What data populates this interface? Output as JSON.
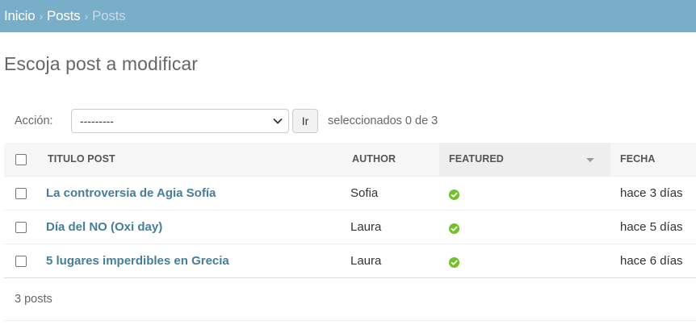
{
  "breadcrumbs": {
    "home": "Inicio",
    "separator": "›",
    "app": "Posts",
    "current": "Posts"
  },
  "page": {
    "title": "Escoja post a modificar"
  },
  "actions": {
    "label": "Acción:",
    "selected_option": "---------",
    "go_label": "Ir",
    "counter": "seleccionados 0 de 3"
  },
  "table": {
    "headers": {
      "title": "Titulo post",
      "author": "Author",
      "featured": "Featured",
      "date": "Fecha"
    },
    "rows": [
      {
        "title": "La controversia de Agia Sofía",
        "author": "Sofia",
        "featured": true,
        "date": "hace 3 días"
      },
      {
        "title": "Día del NO (Oxi day)",
        "author": "Laura",
        "featured": true,
        "date": "hace 5 días"
      },
      {
        "title": "5 lugares imperdibles en Grecia",
        "author": "Laura",
        "featured": true,
        "date": "hace 6 días"
      }
    ]
  },
  "paginator": {
    "text": "3 posts"
  },
  "colors": {
    "header_bg": "#79aec8",
    "link": "#447e9b",
    "check_green": "#70bf2b"
  }
}
